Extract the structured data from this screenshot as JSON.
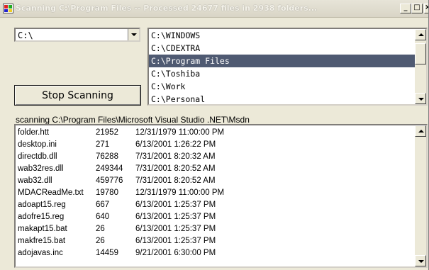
{
  "window": {
    "title": "Scanning C:\\Program Files -- Processed 24677 files in 2938 folders...",
    "controls": {
      "minimize": "_",
      "maximize": "□",
      "close": "×"
    }
  },
  "drive_combo": {
    "value": "C:\\"
  },
  "folder_list": {
    "items": [
      {
        "label": "C:\\WINDOWS"
      },
      {
        "label": "C:\\CDEXTRA"
      },
      {
        "label": "C:\\Program Files"
      },
      {
        "label": "C:\\Toshiba"
      },
      {
        "label": "C:\\Work"
      },
      {
        "label": "C:\\Personal"
      }
    ],
    "selected": "C:\\Program Files"
  },
  "stop_button": {
    "label": "Stop Scanning"
  },
  "status": {
    "text": "scanning C:\\Program Files\\Microsoft Visual Studio .NET\\Msdn"
  },
  "file_list": {
    "rows": [
      {
        "name": "folder.htt",
        "size": "21952",
        "date": "12/31/1979 11:00:00 PM"
      },
      {
        "name": "desktop.ini",
        "size": "271",
        "date": "6/13/2001 1:26:22 PM"
      },
      {
        "name": "directdb.dll",
        "size": "76288",
        "date": "7/31/2001 8:20:32 AM"
      },
      {
        "name": "wab32res.dll",
        "size": "249344",
        "date": "7/31/2001 8:20:52 AM"
      },
      {
        "name": "wab32.dll",
        "size": "459776",
        "date": "7/31/2001 8:20:52 AM"
      },
      {
        "name": "MDACReadMe.txt",
        "size": "19780",
        "date": "12/31/1979 11:00:00 PM"
      },
      {
        "name": "adoapt15.reg",
        "size": "667",
        "date": "6/13/2001 1:25:37 PM"
      },
      {
        "name": "adofre15.reg",
        "size": "640",
        "date": "6/13/2001 1:25:37 PM"
      },
      {
        "name": "makapt15.bat",
        "size": "26",
        "date": "6/13/2001 1:25:37 PM"
      },
      {
        "name": "makfre15.bat",
        "size": "26",
        "date": "6/13/2001 1:25:37 PM"
      },
      {
        "name": "adojavas.inc",
        "size": "14459",
        "date": "9/21/2001 6:30:00 PM"
      }
    ]
  },
  "colors": {
    "selection": "#4f5a72",
    "window_bg": "#ece9d8"
  },
  "icons": {
    "app": "app-icon",
    "dropdown": "chevron-down-icon",
    "scroll_up": "scroll-up-icon",
    "scroll_down": "scroll-down-icon"
  }
}
